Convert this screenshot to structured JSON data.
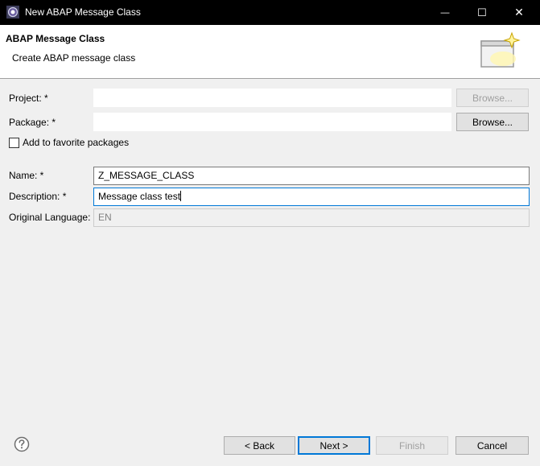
{
  "window": {
    "title": "New ABAP Message Class",
    "minimize_glyph": "—",
    "maximize_glyph": "☐",
    "close_glyph": "✕"
  },
  "header": {
    "title": "ABAP Message Class",
    "subtitle": "Create ABAP message class",
    "icon": "wizard-sparkle-icon"
  },
  "form": {
    "project": {
      "label": "Project: *",
      "value": "",
      "browse_label": "Browse...",
      "browse_enabled": false
    },
    "package": {
      "label": "Package: *",
      "value": "",
      "browse_label": "Browse..."
    },
    "favorite": {
      "label": "Add to favorite packages",
      "checked": false
    },
    "name": {
      "label": "Name: *",
      "value": "Z_MESSAGE_CLASS"
    },
    "description": {
      "label": "Description: *",
      "value": "Message class test"
    },
    "language": {
      "label": "Original Language:",
      "value": "EN"
    }
  },
  "footer": {
    "help_icon": "help-question-icon",
    "back_label": "< Back",
    "next_label": "Next >",
    "finish_label": "Finish",
    "cancel_label": "Cancel"
  }
}
